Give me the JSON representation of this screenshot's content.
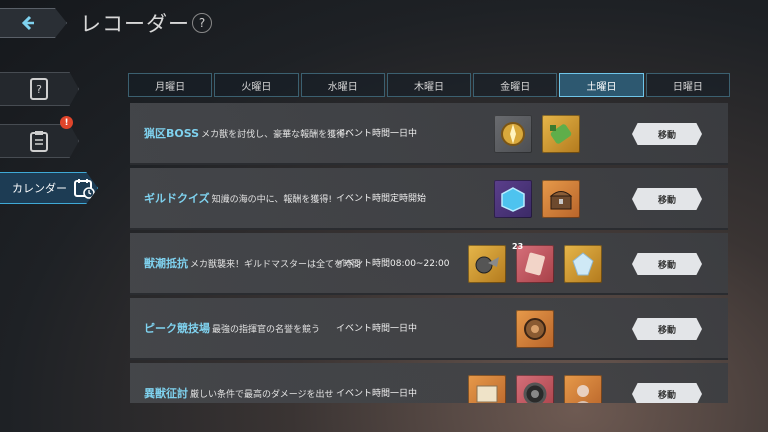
{
  "header": {
    "title": "レコーダー",
    "help_label": "?"
  },
  "sidebar": {
    "items": [
      {
        "icon": "question-book-icon"
      },
      {
        "icon": "clipboard-icon",
        "badge": "!"
      },
      {
        "icon": "calendar-icon",
        "label": "カレンダー",
        "active": true
      }
    ]
  },
  "tabs": [
    {
      "label": "月曜日"
    },
    {
      "label": "火曜日"
    },
    {
      "label": "水曜日"
    },
    {
      "label": "木曜日"
    },
    {
      "label": "金曜日"
    },
    {
      "label": "土曜日",
      "active": true
    },
    {
      "label": "日曜日"
    }
  ],
  "events": [
    {
      "name": "猟区BOSS",
      "desc": "メカ獣を討伐し、豪華な報酬を獲得!",
      "time": "イベント時間一日中",
      "rewards": [
        "gold-compass-icon",
        "green-scroll-icon"
      ],
      "button": "移動"
    },
    {
      "name": "ギルドクイズ",
      "desc": "知識の海の中に、報酬を獲得!",
      "time": "イベント時間定時開始",
      "rewards": [
        "blue-cube-icon",
        "treasure-chest-icon"
      ],
      "button": "移動"
    },
    {
      "name": "獣潮抵抗",
      "desc": "メカ獣襲来！ギルドマスターは全てを時間",
      "time": "イベント時間08:00~22:00",
      "rewards": [
        "drill-part-icon",
        "red-card-icon",
        "ice-crystal-icon"
      ],
      "button": "移動"
    },
    {
      "name": "ピーク競技場",
      "desc": "最強の指揮官の名誉を競う",
      "time": "イベント時間一日中",
      "rewards": [
        "gear-armor-icon"
      ],
      "button": "移動"
    },
    {
      "name": "異獣征討",
      "desc": "厳しい条件で最高のダメージを出せ",
      "time": "イベント時間一日中",
      "rewards": [
        "map-scroll-icon",
        "tire-part-icon",
        "portrait-card-icon"
      ],
      "button": "移動"
    }
  ]
}
